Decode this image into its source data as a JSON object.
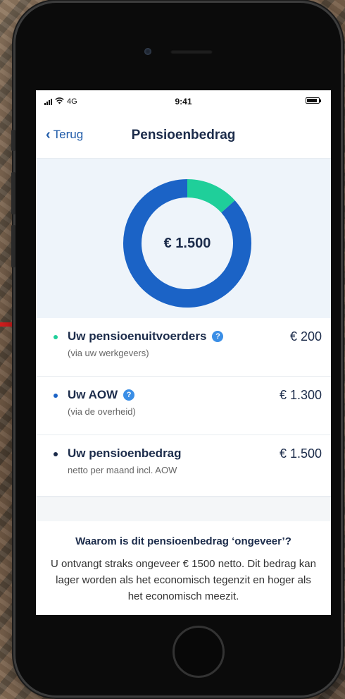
{
  "status": {
    "network": "4G",
    "time": "9:41"
  },
  "nav": {
    "back_label": "Terug",
    "title": "Pensioenbedrag"
  },
  "chart_data": {
    "type": "pie",
    "center_label": "€ 1.500",
    "slices": [
      {
        "name": "Uw pensioenuitvoerders",
        "value": 200,
        "color": "#1fcf9a"
      },
      {
        "name": "Uw AOW",
        "value": 1300,
        "color": "#1b63c6"
      }
    ]
  },
  "rows": [
    {
      "title": "Uw pensioenuitvoerders",
      "sub": "(via uw werkgevers)",
      "amount": "€ 200",
      "dot_color": "#1fcf9a",
      "help": "?"
    },
    {
      "title": "Uw AOW",
      "sub": "(via de overheid)",
      "amount": "€ 1.300",
      "dot_color": "#1b63c6",
      "help": "?"
    },
    {
      "title": "Uw pensioenbedrag",
      "sub": "netto per maand incl. AOW",
      "amount": "€ 1.500",
      "dot_color": "#1b2b4a"
    }
  ],
  "info": {
    "heading": "Waarom is dit pensioenbedrag ‘ongeveer’?",
    "body": "U ontvangt straks ongeveer € 1500 netto. Dit bedrag kan lager worden als het economisch tegenzit en hoger als het economisch meezit."
  }
}
